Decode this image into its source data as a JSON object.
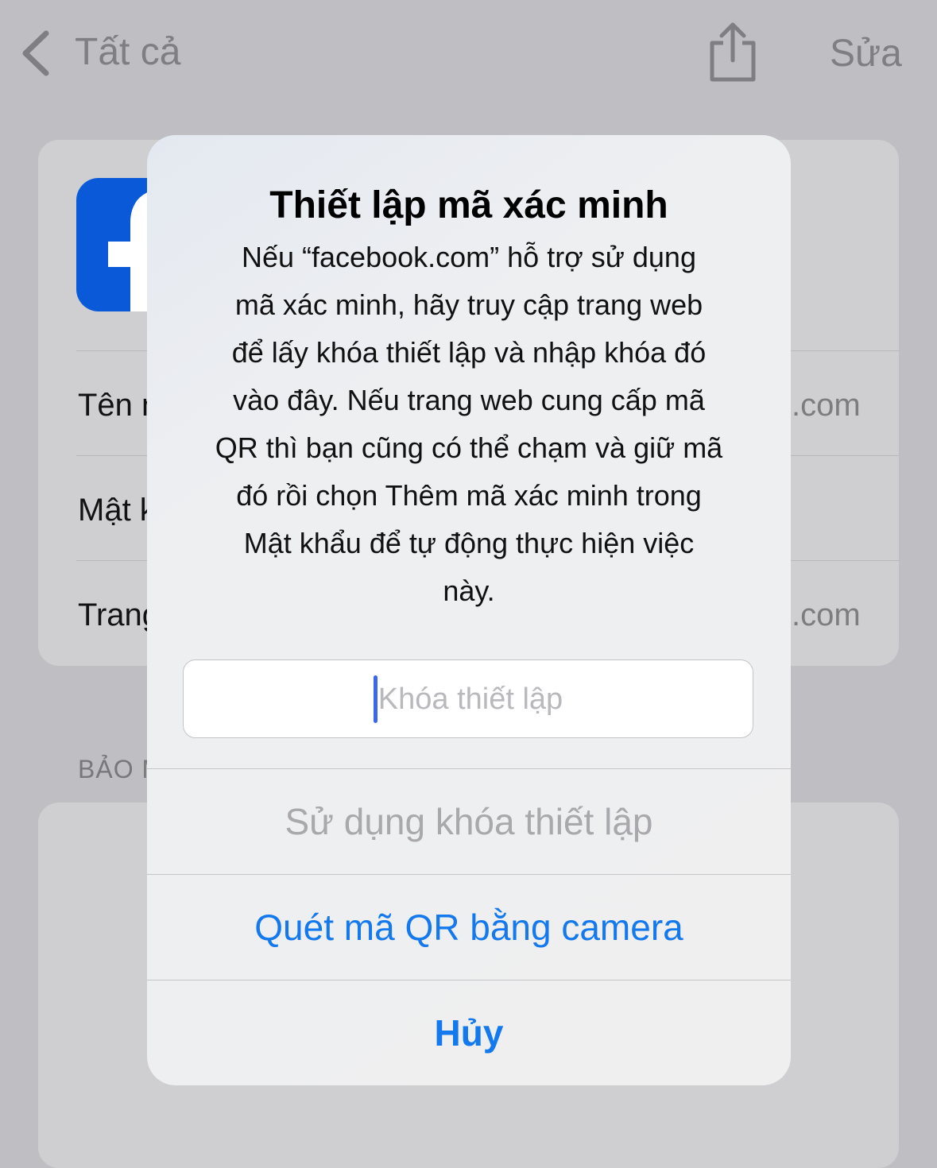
{
  "nav": {
    "back_label": "Tất cả",
    "edit_label": "Sửa"
  },
  "account": {
    "logo_icon": "facebook-icon",
    "rows": [
      {
        "label": "Tên n",
        "value": ".com"
      },
      {
        "label": "Mật k",
        "value": ""
      },
      {
        "label": "Trang",
        "value": ".com"
      }
    ],
    "section_header": "BẢO M"
  },
  "alert": {
    "title": "Thiết lập mã xác minh",
    "message_lines": [
      "Nếu “facebook.com” hỗ trợ sử dụng",
      "mã xác minh, hãy truy cập trang web",
      "để lấy khóa thiết lập và nhập khóa đó",
      "vào đây. Nếu trang web cung cấp mã",
      "QR thì bạn cũng có thể chạm và giữ mã",
      "đó rồi chọn Thêm mã xác minh trong",
      "Mật khẩu để tự động thực hiện việc",
      "này."
    ],
    "input_placeholder": "Khóa thiết lập",
    "actions": {
      "use_key": "Sử dụng khóa thiết lập",
      "scan_qr": "Quét mã QR bằng camera",
      "cancel": "Hủy"
    }
  },
  "colors": {
    "accent": "#1579ee",
    "facebook_blue": "#0a59d8",
    "dim_background": "#bfbfc3"
  }
}
